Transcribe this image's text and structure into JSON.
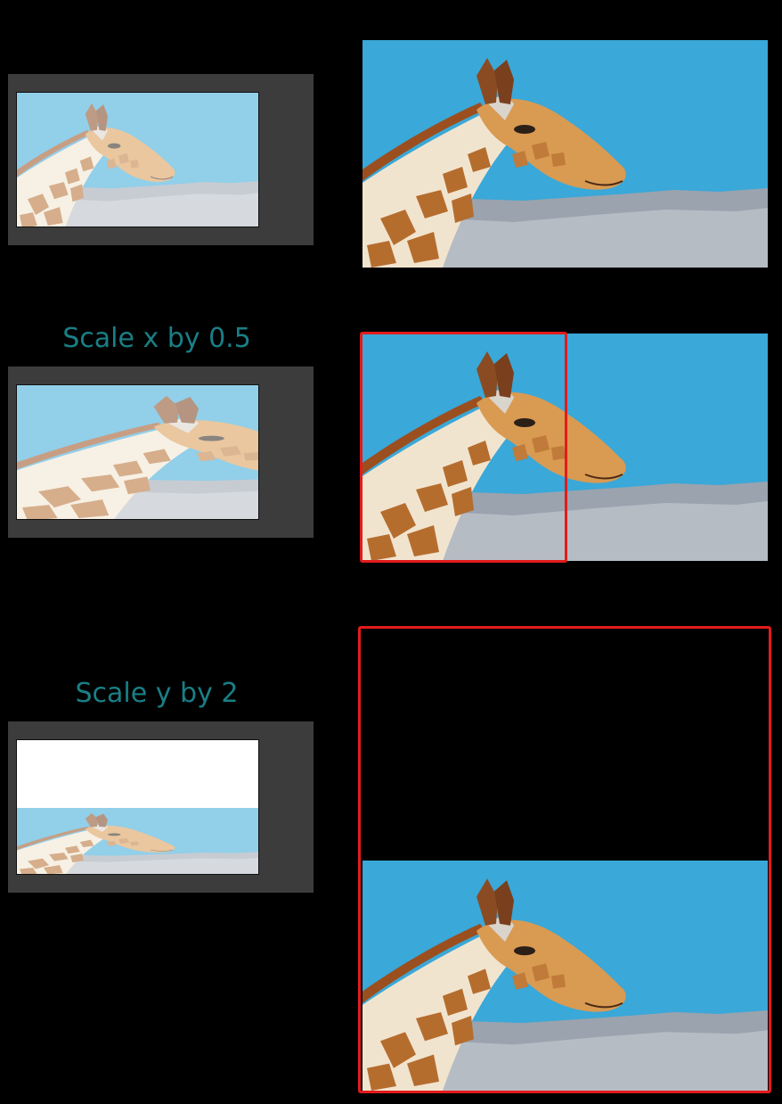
{
  "rows": [
    {
      "label": ""
    },
    {
      "label": "Scale x by 0.5"
    },
    {
      "label": "Scale y by 2"
    }
  ],
  "colors": {
    "background": "#000000",
    "panel": "#3c3c3c",
    "label": "#1a7f86",
    "highlight": "#e21b1b",
    "sky": "#3aa6d6",
    "sky_faded": "#8fd0ea",
    "mountains": "#aab0b8",
    "giraffe_base": "#efe3cf",
    "giraffe_patch": "#b06a2c"
  },
  "icons": [
    "giraffe-image"
  ]
}
